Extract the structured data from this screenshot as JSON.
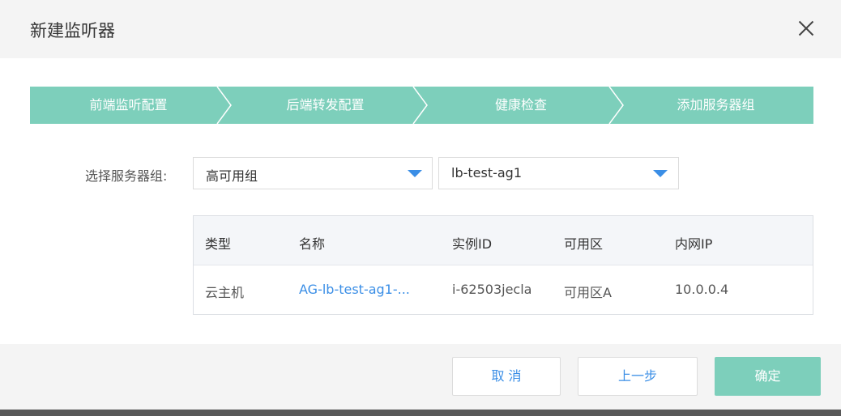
{
  "dialog": {
    "title": "新建监听器"
  },
  "steps": [
    {
      "label": "前端监听配置"
    },
    {
      "label": "后端转发配置"
    },
    {
      "label": "健康检查"
    },
    {
      "label": "添加服务器组"
    }
  ],
  "server_group": {
    "label": "选择服务器组:",
    "type_select": {
      "value": "高可用组"
    },
    "group_select": {
      "value": "lb-test-ag1"
    }
  },
  "table": {
    "headers": [
      "类型",
      "名称",
      "实例ID",
      "可用区",
      "内网IP"
    ],
    "rows": [
      [
        "云主机",
        "AG-lb-test-ag1-...",
        "i-62503jecla",
        "可用区A",
        "10.0.0.4"
      ]
    ]
  },
  "footer": {
    "cancel_label": "取 消",
    "prev_label": "上一步",
    "confirm_label": "确定"
  },
  "colors": {
    "accent_teal": "#7dcfbb",
    "link_blue": "#3a8ee6"
  },
  "icons": {
    "close": "close-icon",
    "dropdown": "caret-down-icon",
    "step_separator": "chevron-right-icon"
  }
}
